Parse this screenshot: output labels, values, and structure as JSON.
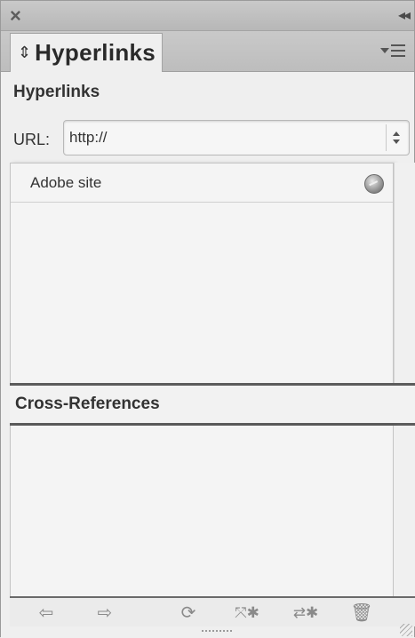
{
  "panel": {
    "tab_label": "Hyperlinks",
    "section_title": "Hyperlinks",
    "url": {
      "label": "URL:",
      "value": "http://"
    },
    "hyperlinks": [
      {
        "label": "Adobe site",
        "icon": "globe-icon"
      }
    ],
    "cross_references": {
      "title": "Cross-References",
      "items": []
    },
    "toolbar_icons": [
      "go-to-source-icon",
      "go-to-destination-icon",
      "update-icon",
      "create-new-cross-reference-icon",
      "create-new-hyperlink-icon",
      "delete-icon"
    ]
  }
}
